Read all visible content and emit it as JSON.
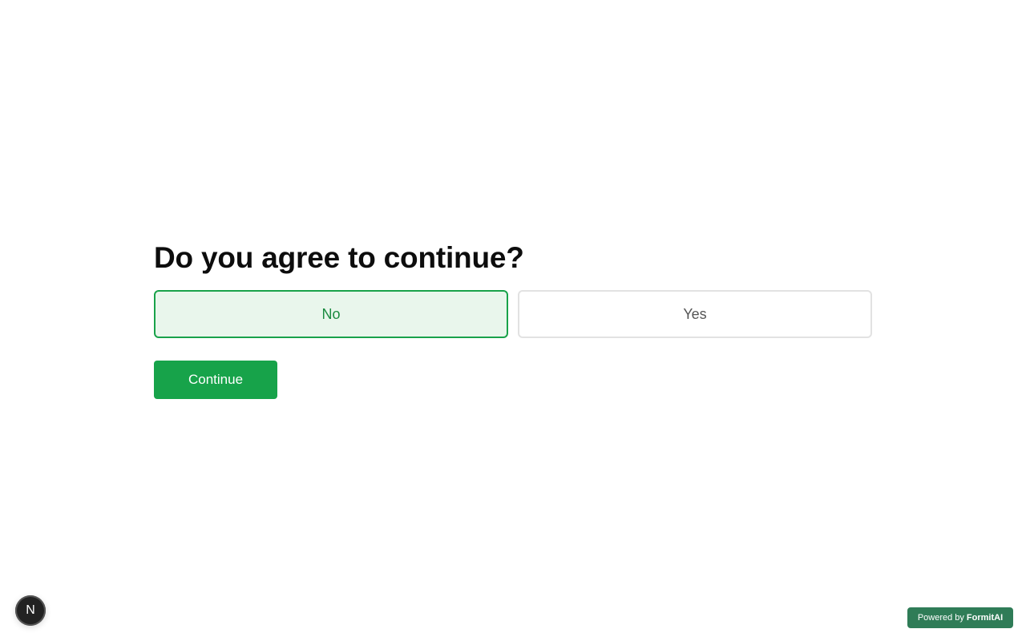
{
  "question": "Do you agree to continue?",
  "options": [
    {
      "label": "No",
      "selected": true
    },
    {
      "label": "Yes",
      "selected": false
    }
  ],
  "continue_label": "Continue",
  "badge": {
    "letter": "N"
  },
  "powered_by": {
    "prefix": "Powered by",
    "brand": "FormitAI"
  },
  "colors": {
    "accent": "#17a34a",
    "selected_bg": "#e9f6ec",
    "powered_bg": "#2f7c57"
  }
}
